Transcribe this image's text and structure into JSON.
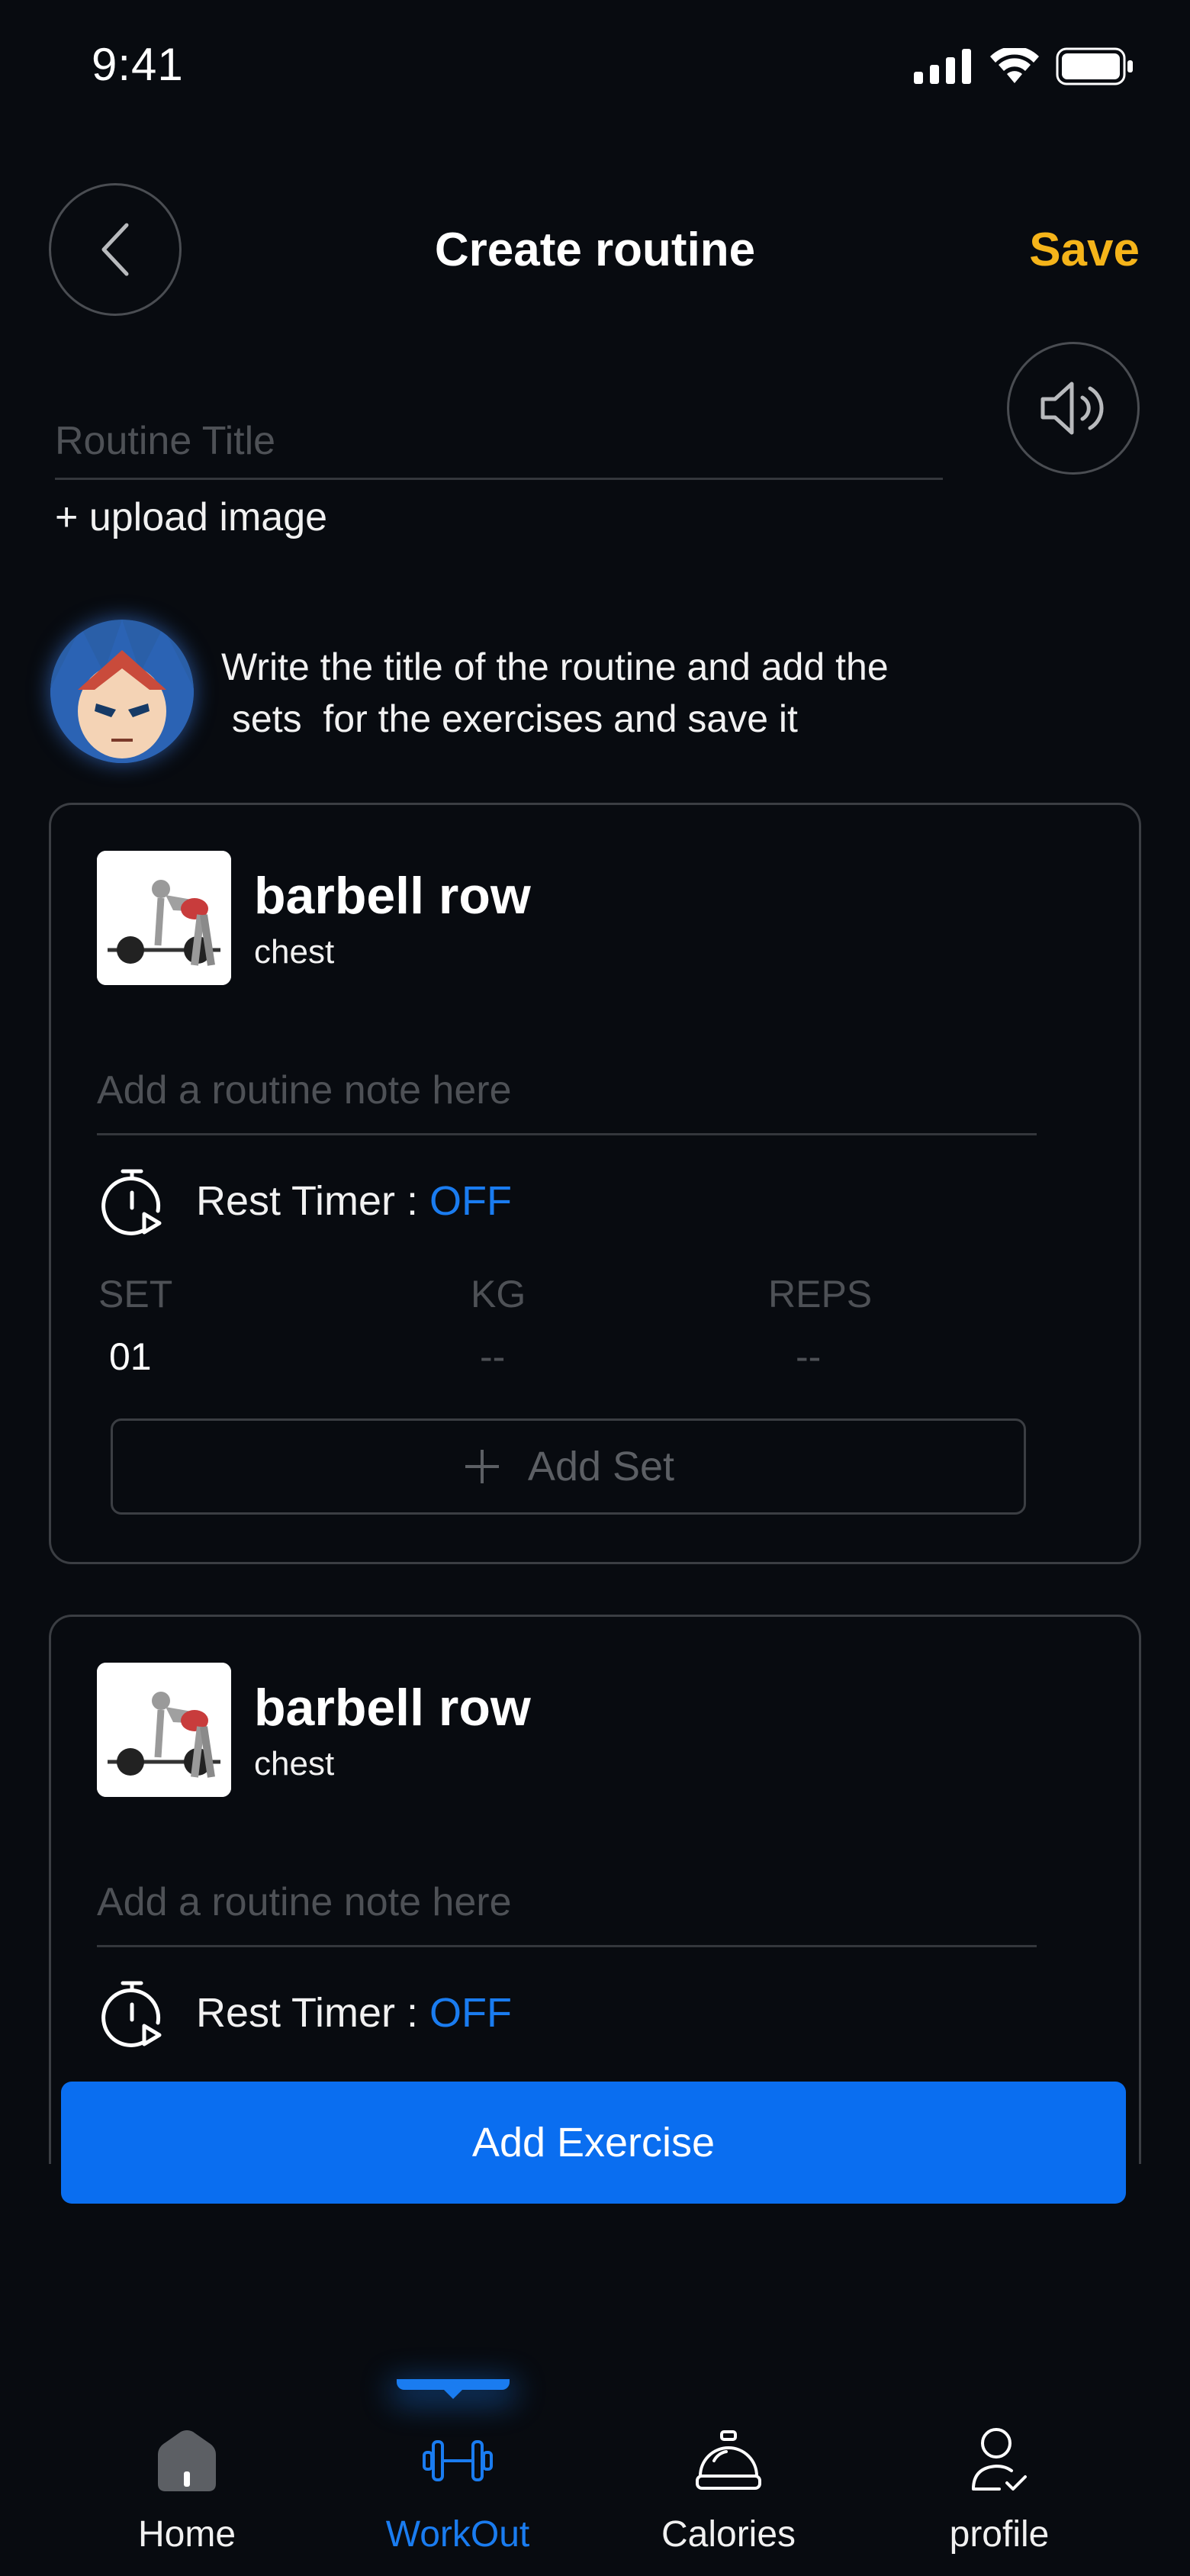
{
  "status_bar": {
    "time": "9:41"
  },
  "header": {
    "title": "Create routine",
    "save_label": "Save"
  },
  "routine": {
    "title_placeholder": "Routine Title",
    "upload_label": "+ upload image"
  },
  "hint": {
    "line1": "Write the title of the routine and add the",
    "line2": " sets  for the exercises and save it"
  },
  "exercises": [
    {
      "name": "barbell row",
      "muscle": "chest",
      "note_placeholder": "Add a routine note here",
      "rest_timer_label": "Rest Timer : ",
      "rest_timer_value": "OFF",
      "columns": [
        "SET",
        "KG",
        "REPS"
      ],
      "sets": [
        {
          "set": "01",
          "kg": "--",
          "reps": "--"
        }
      ],
      "add_set_label": "Add Set"
    },
    {
      "name": "barbell row",
      "muscle": "chest",
      "note_placeholder": "Add a routine note here",
      "rest_timer_label": "Rest Timer : ",
      "rest_timer_value": "OFF"
    }
  ],
  "add_exercise_label": "Add Exercise",
  "tabbar": {
    "items": [
      {
        "label": "Home",
        "icon": "home-icon"
      },
      {
        "label": "WorkOut",
        "icon": "dumbbell-icon",
        "active": true
      },
      {
        "label": "Calories",
        "icon": "bell-icon"
      },
      {
        "label": "profile",
        "icon": "user-check-icon"
      }
    ]
  },
  "colors": {
    "accent": "#1a7cf0",
    "save": "#f5b41a",
    "background": "#080b10"
  }
}
